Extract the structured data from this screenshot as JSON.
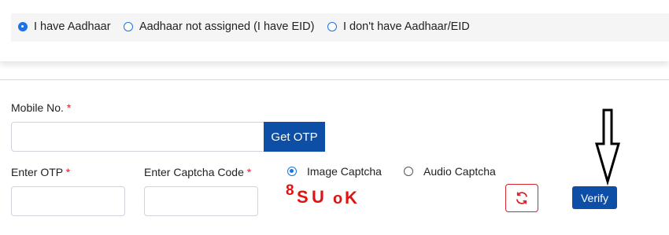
{
  "id_type": {
    "options": [
      {
        "label": "I have Aadhaar",
        "selected": true
      },
      {
        "label": "Aadhaar not assigned (I have EID)",
        "selected": false
      },
      {
        "label": "I don't have Aadhaar/EID",
        "selected": false
      }
    ]
  },
  "form": {
    "mobile_label": "Mobile No.",
    "required_mark": "*",
    "mobile_value": "",
    "get_otp_label": "Get OTP",
    "otp_label": "Enter OTP",
    "otp_value": "",
    "captcha_code_label": "Enter Captcha Code",
    "captcha_value": "",
    "captcha_type_options": [
      {
        "label": "Image Captcha",
        "selected": true
      },
      {
        "label": "Audio Captcha",
        "selected": false
      }
    ],
    "captcha_chars": [
      "8",
      "S",
      "U",
      "o",
      "K"
    ],
    "verify_label": "Verify"
  },
  "colors": {
    "primary": "#0d4ea6",
    "radio_accent": "#1a73e8",
    "required": "#d9232d",
    "captcha_text": "#e01212"
  },
  "icons": {
    "refresh": "refresh-icon",
    "annotation": "down-arrow-icon"
  }
}
